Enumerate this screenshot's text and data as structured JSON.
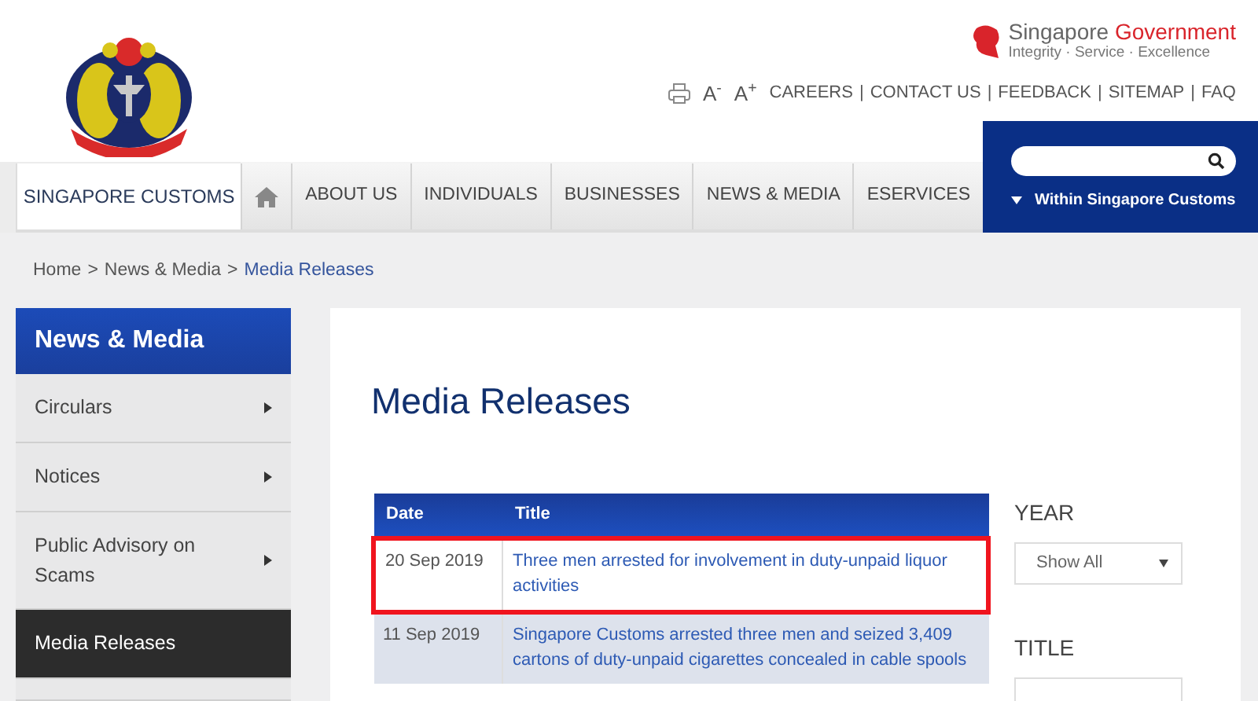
{
  "header": {
    "site_name": "SINGAPORE CUSTOMS",
    "gov": {
      "brand": "Singapore",
      "brand_accent": "Government",
      "tagline": "Integrity · Service · Excellence"
    },
    "font_buttons": [
      "A$^{-}$",
      "A$^{+}$"
    ],
    "separator": "|",
    "links": [
      "CAREERS",
      "CONTACT US",
      "FEEDBACK",
      "SITEMAP",
      "FAQ"
    ]
  },
  "nav": {
    "tabs": [
      {
        "label": "ABOUT US",
        "selected": false
      },
      {
        "label": "INDIVIDUALS",
        "selected": false
      },
      {
        "label": "BUSINESSES",
        "selected": false
      },
      {
        "label": "NEWS & MEDIA",
        "selected": false
      },
      {
        "label": "ESERVICES",
        "selected": false
      }
    ]
  },
  "search": {
    "scope": "Within Singapore Customs"
  },
  "breadcrumb": {
    "separator": ">",
    "items": [
      {
        "label": "Home",
        "selected": false
      },
      {
        "label": "News & Media",
        "selected": false
      },
      {
        "label": "Media Releases",
        "selected": true
      }
    ]
  },
  "sidebar": {
    "title": "News & Media",
    "items": [
      {
        "label": "Circulars",
        "has_submenu": true,
        "selected": false
      },
      {
        "label": "Notices",
        "has_submenu": true,
        "selected": false
      },
      {
        "label": "Public Advisory on Scams",
        "has_submenu": true,
        "selected": false
      },
      {
        "label": "Media Releases",
        "has_submenu": false,
        "selected": true
      }
    ]
  },
  "page_title": "Media Releases",
  "table": {
    "columns": [
      "Date",
      "Title"
    ],
    "rows": [
      {
        "date": "20 Sep 2019",
        "title": "Three men arrested for involvement in duty-unpaid liquor activities",
        "highlighted": true
      },
      {
        "date": "11 Sep 2019",
        "title": "Singapore Customs arrested three men and seized 3,409 cartons of duty-unpaid cigarettes concealed in cable spools",
        "highlighted": false
      }
    ]
  },
  "filters": {
    "year_label": "YEAR",
    "year_value": "Show All",
    "title_label": "TITLE"
  }
}
